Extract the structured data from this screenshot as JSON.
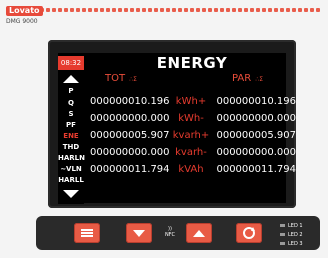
{
  "brand": {
    "name": "Lovato",
    "model": "DMG 9000"
  },
  "screen": {
    "time": "08:32",
    "title": "ENERGY",
    "columns": {
      "left": "TOT",
      "right": "PAR"
    },
    "rows": [
      {
        "left": "000000010.196",
        "unit": "kWh+",
        "right": "000000010.196"
      },
      {
        "left": "000000000.000",
        "unit": "kWh-",
        "right": "000000000.000"
      },
      {
        "left": "000000005.907",
        "unit": "kvarh+",
        "right": "000000005.907"
      },
      {
        "left": "000000000.000",
        "unit": "kvarh-",
        "right": "000000000.000"
      },
      {
        "left": "000000011.794",
        "unit": "kVAh",
        "right": "000000011.794"
      }
    ],
    "menu": [
      "P",
      "Q",
      "S",
      "PF",
      "ENE",
      "THD",
      "HARLN",
      "~VLN",
      "HARLL"
    ],
    "active_menu": "ENE"
  },
  "keypad": {
    "keys": [
      "menu-key",
      "down-key",
      "up-key",
      "reset-key"
    ],
    "nfc_label": "NFC"
  },
  "leds": [
    "LED 1",
    "LED 2",
    "LED 3"
  ]
}
